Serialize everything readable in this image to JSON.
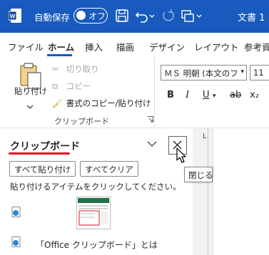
{
  "titlebar": {
    "autosave_label": "自動保存",
    "autosave_state": "オフ",
    "doc_title": "文書 1",
    "bg_color": "#185abd"
  },
  "tabs": [
    {
      "label": "ファイル"
    },
    {
      "label": "ホーム",
      "active": true
    },
    {
      "label": "挿入"
    },
    {
      "label": "描画"
    },
    {
      "label": "デザイン"
    },
    {
      "label": "レイアウト"
    },
    {
      "label": "参考資"
    }
  ],
  "ribbon": {
    "paste_label": "貼り付け",
    "cut_label": "切り取り",
    "copy_label": "コピー",
    "format_painter_label": "書式のコピー/貼り付け",
    "group_label": "クリップボード",
    "font_name": "ＭＳ 明朝 (本文のフ",
    "font_size": "11",
    "format_buttons": [
      "B",
      "I",
      "U",
      "ab",
      "x₂"
    ]
  },
  "ruler": {
    "mark": "L"
  },
  "pane": {
    "title": "クリップボード",
    "paste_all": "すべて貼り付け",
    "clear_all": "すべてクリア",
    "hint": "貼り付けるアイテムをクリックしてください。",
    "link_text": "「Office クリップボード」とは",
    "accent_color": "#e81123"
  },
  "tooltip": {
    "text": "閉じる"
  }
}
